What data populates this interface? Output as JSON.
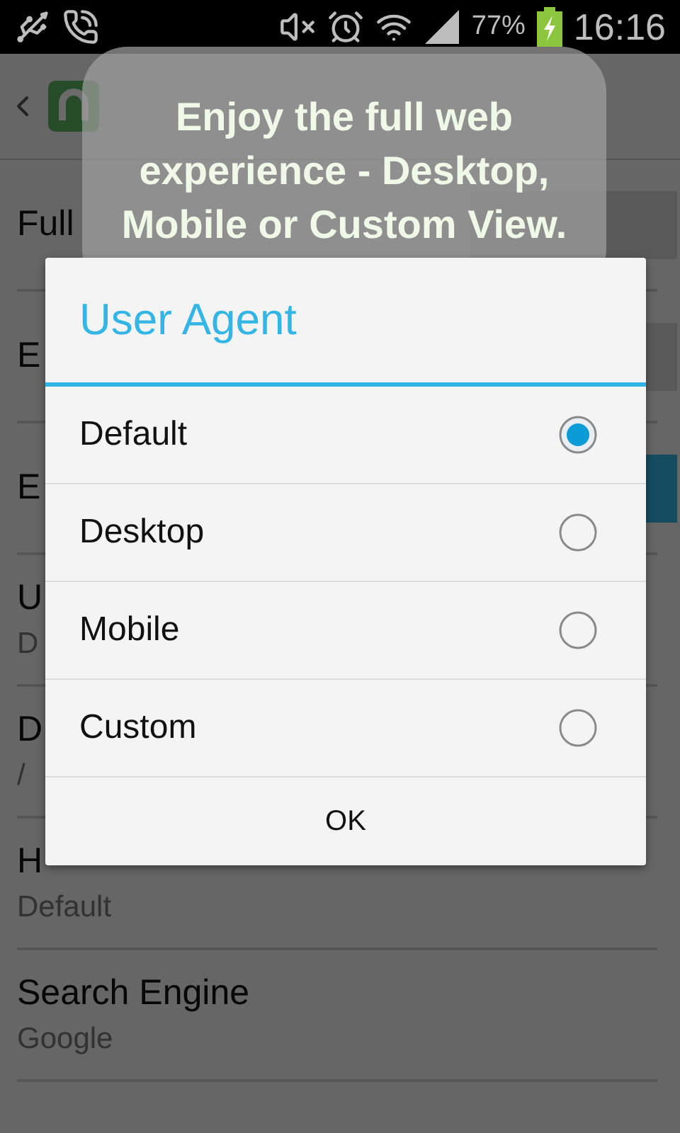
{
  "status_bar": {
    "battery": "77%",
    "time": "16:16"
  },
  "settings": [
    {
      "kind": "toggle",
      "title": "Full",
      "on": false
    },
    {
      "kind": "toggle",
      "title": "E",
      "on": false
    },
    {
      "kind": "toggle",
      "title": "E",
      "on": true
    },
    {
      "kind": "value",
      "title": "U",
      "summary": "D"
    },
    {
      "kind": "value",
      "title": "D",
      "summary": "/"
    },
    {
      "kind": "value",
      "title": "H",
      "summary": "Default"
    },
    {
      "kind": "value",
      "title": "Search Engine",
      "summary": "Google"
    }
  ],
  "toast": {
    "text": "Enjoy the full web experience - Desktop, Mobile or Custom View."
  },
  "dialog": {
    "title": "User Agent",
    "options": [
      {
        "label": "Default",
        "selected": true
      },
      {
        "label": "Desktop",
        "selected": false
      },
      {
        "label": "Mobile",
        "selected": false
      },
      {
        "label": "Custom",
        "selected": false
      }
    ],
    "button": "OK"
  }
}
